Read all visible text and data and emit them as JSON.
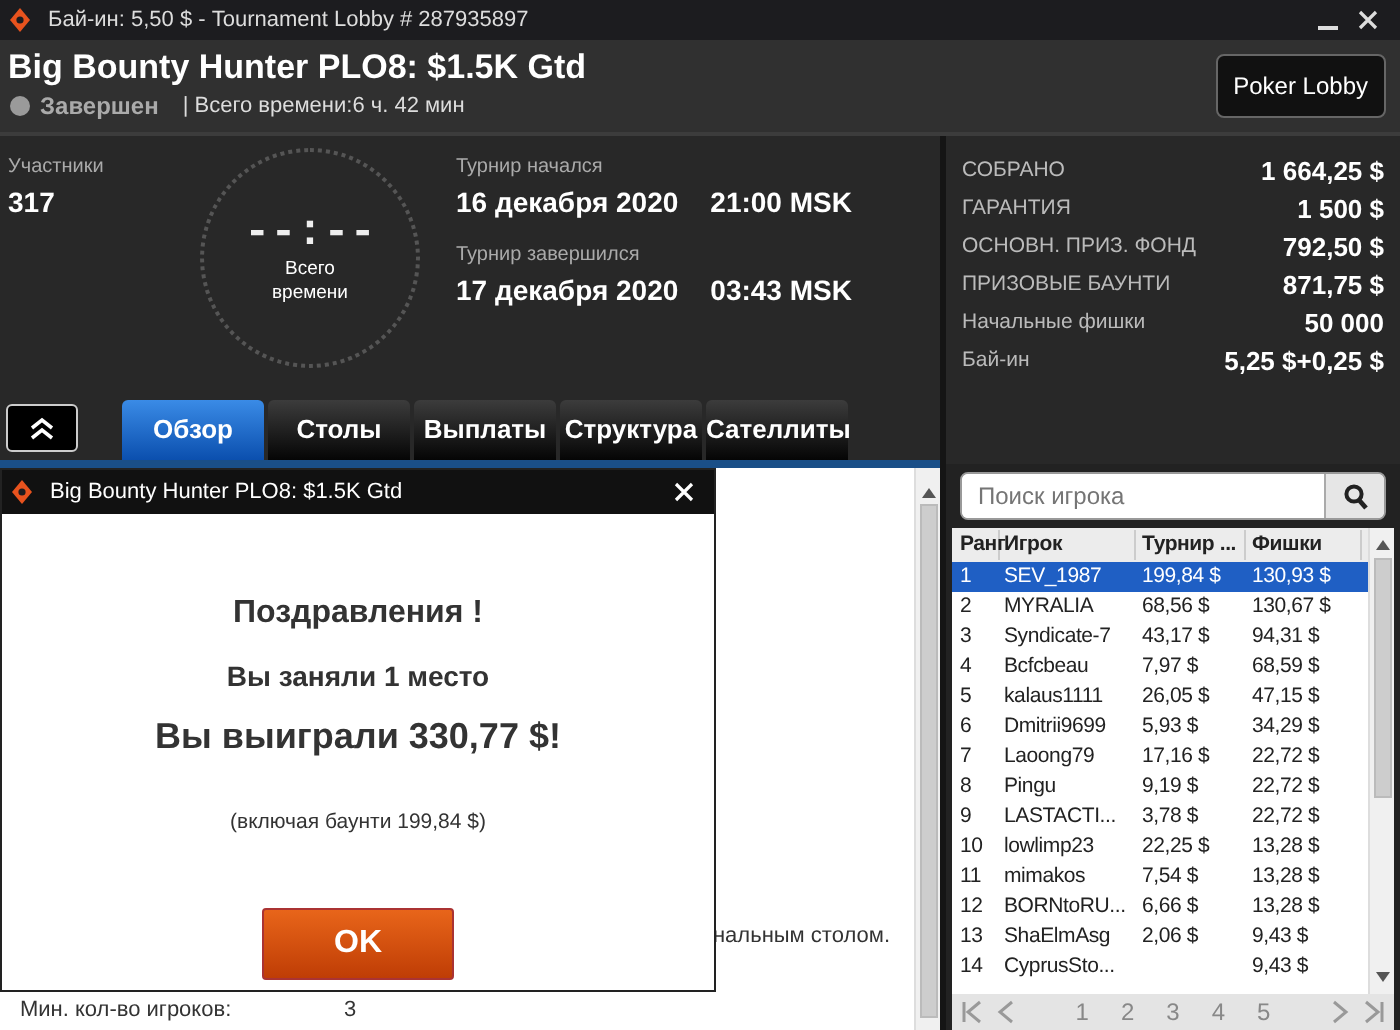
{
  "window": {
    "title": "Бай-ин: 5,50 $ - Tournament Lobby # 287935897"
  },
  "header": {
    "title": "Big Bounty Hunter PLO8: $1.5K Gtd",
    "status": "Завершен",
    "running": false,
    "total_time": "| Всего времени:6 ч. 42 мин",
    "lobby_button": "Poker Lobby"
  },
  "info": {
    "participants_label": "Участники",
    "participants": "317",
    "clock": "--:--",
    "clock_label": "Всего времени",
    "started_label": "Турнир начался",
    "started_date": "16 декабря 2020",
    "started_time": "21:00 MSK",
    "ended_label": "Турнир завершился",
    "ended_date": "17 декабря 2020",
    "ended_time": "03:43 MSK"
  },
  "stats": [
    {
      "label": "СОБРАНО",
      "value": "1 664,25 $"
    },
    {
      "label": "ГАРАНТИЯ",
      "value": "1 500 $"
    },
    {
      "label": "ОСНОВН. ПРИЗ. ФОНД",
      "value": "792,50 $"
    },
    {
      "label": "ПРИЗОВЫЕ БАУНТИ",
      "value": "871,75 $"
    },
    {
      "label": "Начальные фишки",
      "value": "50 000"
    },
    {
      "label": "Бай-ин",
      "value": "5,25 $+0,25 $"
    }
  ],
  "tabs": [
    {
      "label": "Обзор",
      "selected": true
    },
    {
      "label": "Столы",
      "selected": false
    },
    {
      "label": "Выплаты",
      "selected": false
    },
    {
      "label": "Структура",
      "selected": false
    },
    {
      "label": "Сателлиты",
      "selected": false
    }
  ],
  "dialog": {
    "title": "Big Bounty Hunter PLO8: $1.5K Gtd",
    "heading": "Поздравления !",
    "place": "Вы заняли 1 место",
    "win": "Вы выиграли 330,77 $!",
    "bounty": "(включая баунти 199,84 $)",
    "ok": "OK"
  },
  "background": {
    "text_fragment": "нальным столом.",
    "min_players_label": "Мин. кол-во игроков:",
    "min_players": "3"
  },
  "players": {
    "search_placeholder": "Поиск игрока",
    "columns": [
      "Ранг",
      "Игрок",
      "Турнир ...",
      "Фишки"
    ],
    "rows": [
      {
        "rank": "1",
        "player": "SEV_1987",
        "bounty": "199,84 $",
        "chips": "130,93 $",
        "selected": true
      },
      {
        "rank": "2",
        "player": "MYRALIA",
        "bounty": "68,56 $",
        "chips": "130,67 $",
        "selected": false
      },
      {
        "rank": "3",
        "player": "Syndicate-7",
        "bounty": "43,17 $",
        "chips": "94,31 $",
        "selected": false
      },
      {
        "rank": "4",
        "player": "Bcfcbeau",
        "bounty": "7,97 $",
        "chips": "68,59 $",
        "selected": false
      },
      {
        "rank": "5",
        "player": "kalaus1111",
        "bounty": "26,05 $",
        "chips": "47,15 $",
        "selected": false
      },
      {
        "rank": "6",
        "player": "Dmitrii9699",
        "bounty": "5,93 $",
        "chips": "34,29 $",
        "selected": false
      },
      {
        "rank": "7",
        "player": "Laoong79",
        "bounty": "17,16 $",
        "chips": "22,72 $",
        "selected": false
      },
      {
        "rank": "8",
        "player": "Pingu",
        "bounty": "9,19 $",
        "chips": "22,72 $",
        "selected": false
      },
      {
        "rank": "9",
        "player": "LASTACTI...",
        "bounty": "3,78 $",
        "chips": "22,72 $",
        "selected": false
      },
      {
        "rank": "10",
        "player": "lowlimp23",
        "bounty": "22,25 $",
        "chips": "13,28 $",
        "selected": false
      },
      {
        "rank": "11",
        "player": "mimakos",
        "bounty": "7,54 $",
        "chips": "13,28 $",
        "selected": false
      },
      {
        "rank": "12",
        "player": "BORNtoRU...",
        "bounty": "6,66 $",
        "chips": "13,28 $",
        "selected": false
      },
      {
        "rank": "13",
        "player": "ShaElmAsg",
        "bounty": "2,06 $",
        "chips": "9,43 $",
        "selected": false
      },
      {
        "rank": "14",
        "player": "CyprusSto...",
        "chips": "9,43 $",
        "selected": false
      }
    ],
    "pages": [
      "1",
      "2",
      "3",
      "4",
      "5"
    ]
  }
}
